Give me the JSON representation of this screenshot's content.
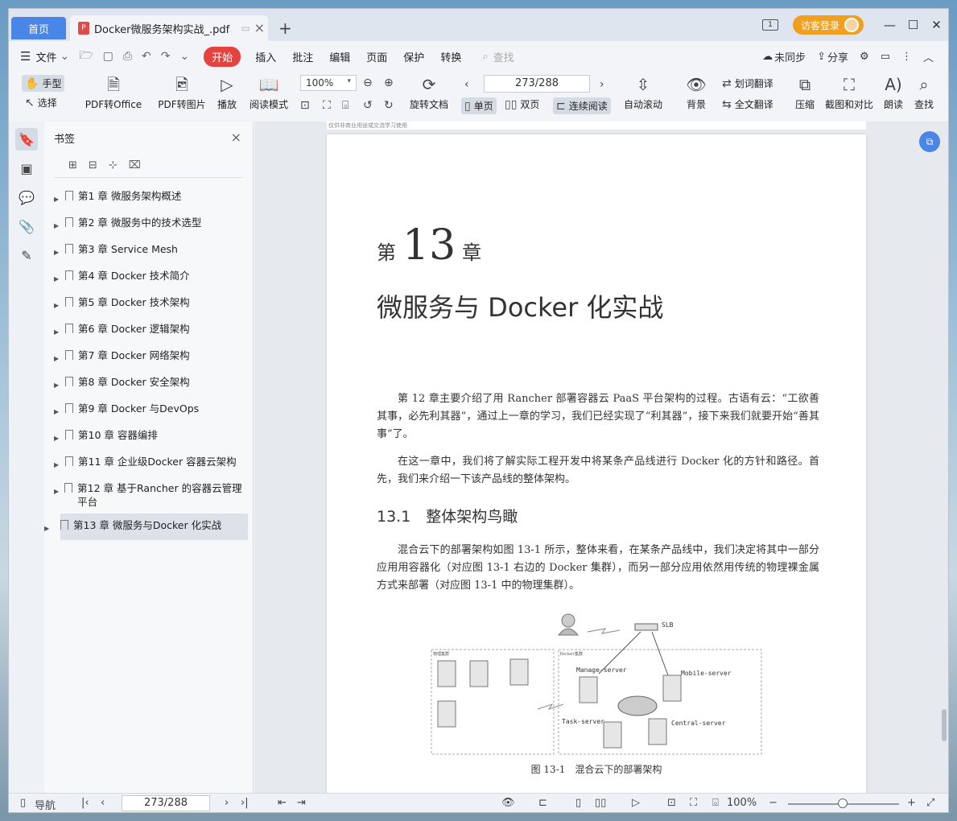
{
  "tabs": {
    "home": "首页",
    "doc_title": "Docker微服务架构实战_.pdf",
    "new_tab": "+"
  },
  "titlebar": {
    "login": "访客登录",
    "page_icon": "1",
    "minimize": "—",
    "maximize": "☐",
    "close": "✕"
  },
  "menu": {
    "file": "文件",
    "start": "开始",
    "items": [
      "插入",
      "批注",
      "编辑",
      "页面",
      "保护",
      "转换"
    ],
    "search": "查找",
    "unsync": "未同步",
    "share": "分享"
  },
  "ribbon": {
    "hand": "手型",
    "select": "选择",
    "pdf_office": "PDF转Office",
    "pdf_image": "PDF转图片",
    "play": "播放",
    "read_mode": "阅读模式",
    "zoom": "100%",
    "rotate": "旋转文档",
    "page_indicator": "273/288",
    "single": "单页",
    "double": "双页",
    "continuous": "连续阅读",
    "auto_scroll": "自动滚动",
    "background": "背景",
    "word_translate": "划词翻译",
    "full_translate": "全文翻译",
    "compress": "压缩",
    "crop_compare": "截图和对比",
    "read_aloud": "朗读",
    "find": "查找"
  },
  "bookmarks": {
    "title": "书签",
    "items": [
      "第1 章 微服务架构概述",
      "第2 章 微服务中的技术选型",
      "第3 章 Service Mesh",
      "第4 章 Docker 技术简介",
      "第5 章 Docker 技术架构",
      "第6 章 Docker 逻辑架构",
      "第7 章 Docker 网络架构",
      "第8 章 Docker 安全架构",
      "第9 章 Docker 与DevOps",
      "第10 章 容器编排",
      "第11 章 企业级Docker 容器云架构",
      "第12 章 基于Rancher 的容器云管理平台",
      "第13 章 微服务与Docker 化实战"
    ],
    "selected_index": 12
  },
  "document": {
    "prev_page_strip": "仅供非商业用途或交流学习使用",
    "chapter_prefix": "第",
    "chapter_num": "13",
    "chapter_suffix": "章",
    "chapter_title": "微服务与 Docker 化实战",
    "para1": "第 12 章主要介绍了用 Rancher 部署容器云 PaaS 平台架构的过程。古语有云：“工欲善其事，必先利其器”，通过上一章的学习，我们已经实现了“利其器”，接下来我们就要开始“善其事”了。",
    "para2": "在这一章中，我们将了解实际工程开发中将某条产品线进行 Docker 化的方针和路径。首先，我们来介绍一下该产品线的整体架构。",
    "section_title": "13.1　整体架构鸟瞰",
    "para3": "混合云下的部署架构如图 13-1 所示，整体来看，在某条产品线中，我们决定将其中一部分应用用容器化（对应图 13-1 右边的 Docker 集群），而另一部分应用依然用传统的物理裸金属方式来部署（对应图 13-1 中的物理集群）。",
    "figure": {
      "slb": "SLB",
      "physical_cluster": "物理集群",
      "docker_cluster": "Docker集群",
      "manage_server": "Manage-server",
      "mobile_server": "Mobile-server",
      "task_server": "Task-server",
      "central_server": "Central-server"
    },
    "figure_caption": "图 13-1　混合云下的部署架构"
  },
  "statusbar": {
    "nav": "导航",
    "page": "273/288",
    "zoom": "100%"
  }
}
